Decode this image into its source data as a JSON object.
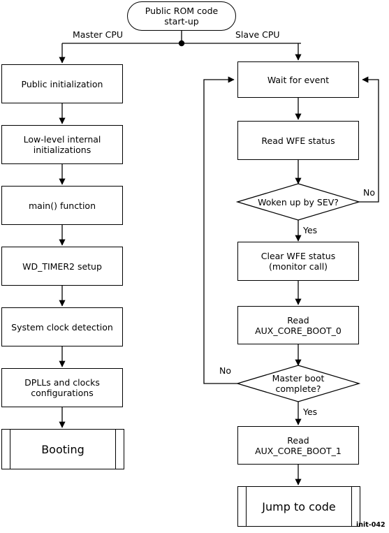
{
  "diagram": {
    "title": "Public ROM code start-up",
    "caption": "init-042",
    "branch_labels": {
      "left": "Master CPU",
      "right": "Slave CPU"
    },
    "decision_labels": {
      "sev_no": "No",
      "sev_yes": "Yes",
      "boot_no": "No",
      "boot_yes": "Yes"
    },
    "start": {
      "label": "Public ROM code\nstart-up",
      "line1": "Public ROM code",
      "line2": "start-up"
    },
    "master_nodes": [
      {
        "id": "public-initialization",
        "label": "Public initialization",
        "shape": "process"
      },
      {
        "id": "low-level-internal-initializations",
        "line1": "Low-level internal",
        "line2": "initializations",
        "shape": "process"
      },
      {
        "id": "main-function",
        "label": "main() function",
        "shape": "process"
      },
      {
        "id": "wd-timer2-setup",
        "label": "WD_TIMER2 setup",
        "shape": "process"
      },
      {
        "id": "system-clock-detection",
        "label": "System clock detection",
        "shape": "process"
      },
      {
        "id": "dplls-and-clocks-configurations",
        "line1": "DPLLs and clocks",
        "line2": "configurations",
        "shape": "process"
      },
      {
        "id": "booting",
        "label": "Booting",
        "shape": "subroutine"
      }
    ],
    "slave_nodes": [
      {
        "id": "wait-for-event",
        "label": "Wait for event",
        "shape": "process"
      },
      {
        "id": "read-wfe-status",
        "label": "Read WFE status",
        "shape": "process"
      },
      {
        "id": "woken-up-by-sev",
        "line1": "Woken up by SEV?",
        "shape": "decision"
      },
      {
        "id": "clear-wfe-status",
        "line1": "Clear WFE status",
        "line2": "(monitor call)",
        "shape": "process"
      },
      {
        "id": "read-aux-core-boot-0",
        "line1": "Read",
        "line2": "AUX_CORE_BOOT_0",
        "shape": "process"
      },
      {
        "id": "master-boot-complete",
        "line1": "Master boot",
        "line2": "complete?",
        "shape": "decision"
      },
      {
        "id": "read-aux-core-boot-1",
        "line1": "Read",
        "line2": "AUX_CORE_BOOT_1",
        "shape": "process"
      },
      {
        "id": "jump-to-code",
        "label": "Jump to code",
        "shape": "subroutine"
      }
    ],
    "colors": {
      "stroke": "#000000",
      "fill": "#ffffff",
      "text": "#000000"
    }
  }
}
